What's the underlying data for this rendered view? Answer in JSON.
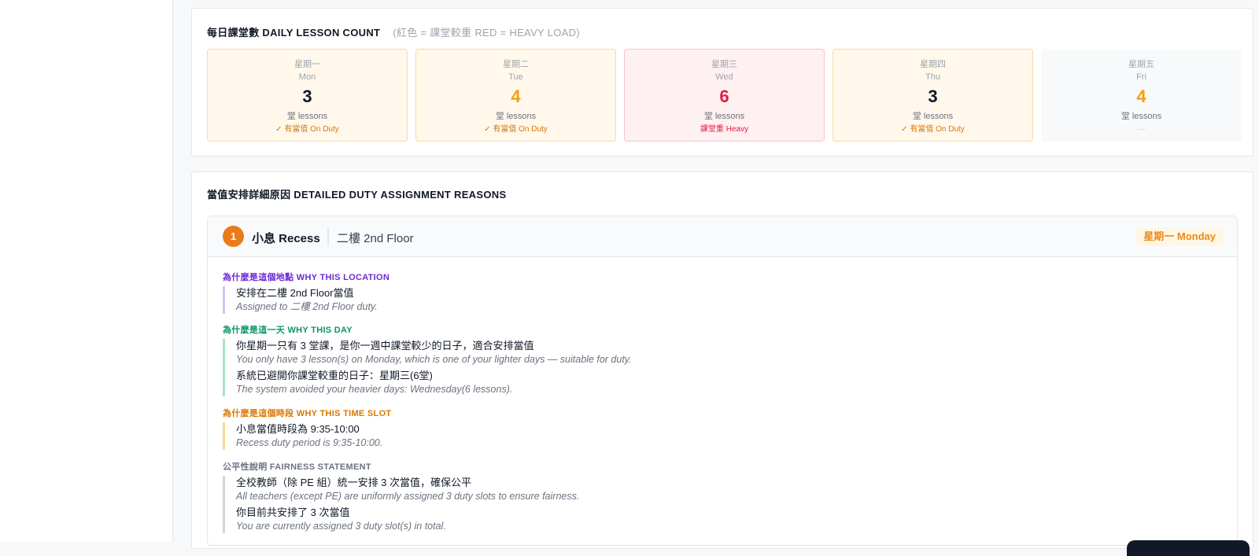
{
  "lessons": {
    "title": "每日課堂數 DAILY LESSON COUNT",
    "note": "(紅色 = 課堂較重 RED = HEAVY LOAD)",
    "days": [
      {
        "zh": "星期一",
        "en": "Mon",
        "count": "3",
        "unit": "堂 lessons",
        "status": "✓ 有當值 On Duty",
        "state": "duty",
        "count_color": "black"
      },
      {
        "zh": "星期二",
        "en": "Tue",
        "count": "4",
        "unit": "堂 lessons",
        "status": "✓ 有當值 On Duty",
        "state": "duty",
        "count_color": "orange"
      },
      {
        "zh": "星期三",
        "en": "Wed",
        "count": "6",
        "unit": "堂 lessons",
        "status": "課堂重 Heavy",
        "state": "heavy",
        "count_color": "red"
      },
      {
        "zh": "星期四",
        "en": "Thu",
        "count": "3",
        "unit": "堂 lessons",
        "status": "✓ 有當值 On Duty",
        "state": "duty",
        "count_color": "black"
      },
      {
        "zh": "星期五",
        "en": "Fri",
        "count": "4",
        "unit": "堂 lessons",
        "status": "—",
        "state": "none",
        "count_color": "orange"
      }
    ]
  },
  "reasons": {
    "title": "當值安排詳細原因 DETAILED DUTY ASSIGNMENT REASONS",
    "duty": {
      "number": "1",
      "slot": "小息 Recess",
      "location": "二樓 2nd Floor",
      "day_tag": "星期一 Monday"
    },
    "sections": {
      "location": {
        "label": "為什麼是這個地點 WHY THIS LOCATION",
        "lines": [
          {
            "zh": "安排在二樓 2nd Floor當值",
            "en": "Assigned to 二樓 2nd Floor duty."
          }
        ]
      },
      "day": {
        "label": "為什麼是這一天 WHY THIS DAY",
        "lines": [
          {
            "zh": "你星期一只有 3 堂課，是你一週中課堂較少的日子，適合安排當值",
            "en": "You only have 3 lesson(s) on Monday, which is one of your lighter days — suitable for duty."
          },
          {
            "zh": "系統已避開你課堂較重的日子：星期三(6堂)",
            "en": "The system avoided your heavier days: Wednesday(6 lessons)."
          }
        ]
      },
      "time": {
        "label": "為什麼是這個時段 WHY THIS TIME SLOT",
        "lines": [
          {
            "zh": "小息當值時段為 9:35-10:00",
            "en": "Recess duty period is 9:35-10:00."
          }
        ]
      },
      "fairness": {
        "label": "公平性說明 FAIRNESS STATEMENT",
        "lines": [
          {
            "zh": "全校教師（除 PE 組）統一安排 3 次當值，確保公平",
            "en": "All teachers (except PE) are uniformly assigned 3 duty slots to ensure fairness."
          },
          {
            "zh": "你目前共安排了 3 次當值",
            "en": "You are currently assigned 3 duty slot(s) in total."
          }
        ]
      }
    }
  }
}
